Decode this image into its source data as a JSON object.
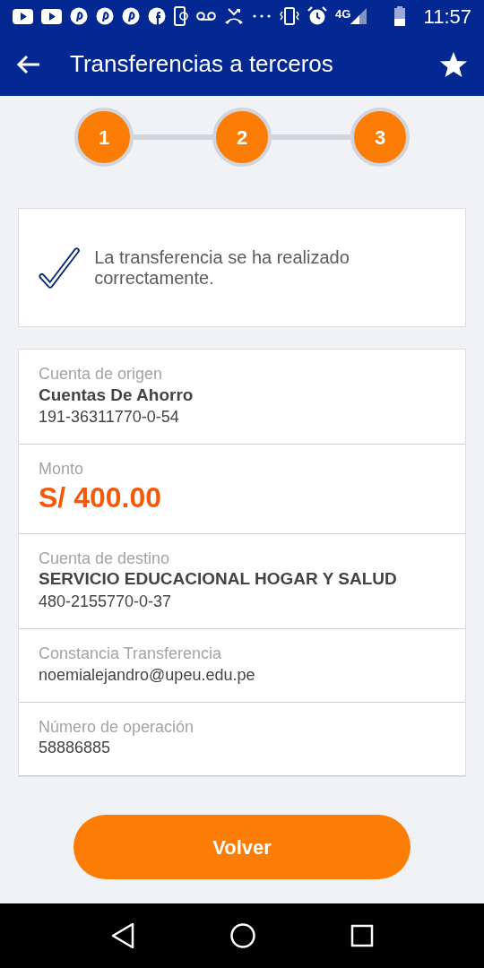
{
  "status_bar": {
    "network": "4G",
    "time": "11:57"
  },
  "app_bar": {
    "title": "Transferencias a terceros"
  },
  "steps": [
    {
      "label": "1",
      "done": true
    },
    {
      "label": "2",
      "done": true
    },
    {
      "label": "3",
      "done": true
    }
  ],
  "message": {
    "text": "La transferencia se ha realizado correctamente."
  },
  "details": [
    {
      "label": "Cuenta de origen",
      "lines": [
        {
          "kind": "bold",
          "text": "Cuentas De Ahorro"
        },
        {
          "kind": "plain",
          "text": "191-36311770-0-54"
        }
      ]
    },
    {
      "label": "Monto",
      "lines": [
        {
          "kind": "amount",
          "text": "S/ 400.00"
        }
      ]
    },
    {
      "label": "Cuenta de destino",
      "lines": [
        {
          "kind": "bold",
          "text": "SERVICIO EDUCACIONAL HOGAR Y SALUD"
        },
        {
          "kind": "plain",
          "text": "480-2155770-0-37"
        }
      ]
    },
    {
      "label": "Constancia Transferencia",
      "lines": [
        {
          "kind": "plain",
          "text": "noemialejandro@upeu.edu.pe"
        }
      ]
    },
    {
      "label": "Número de operación",
      "lines": [
        {
          "kind": "plain",
          "text": "58886885"
        }
      ]
    }
  ],
  "button": {
    "label": "Volver"
  }
}
